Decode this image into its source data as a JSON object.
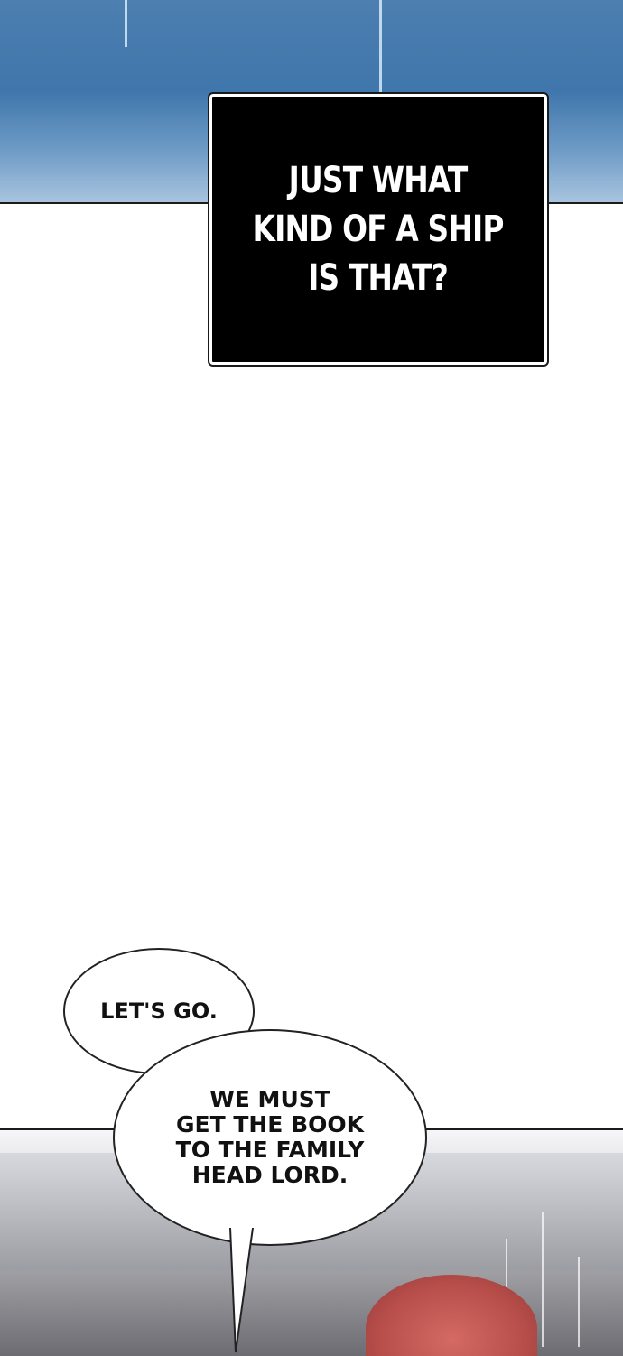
{
  "caption": {
    "text": "JUST WHAT\nKIND OF A SHIP\nIS THAT?"
  },
  "speech_bubbles": [
    {
      "text": "LET'S GO."
    },
    {
      "text": "WE MUST\nGET THE BOOK\nTO THE FAMILY\nHEAD LORD."
    }
  ],
  "colors": {
    "sky": "#3f76ab",
    "caption_bg": "#000000",
    "caption_text": "#ffffff",
    "hair": "#b84e4a"
  }
}
